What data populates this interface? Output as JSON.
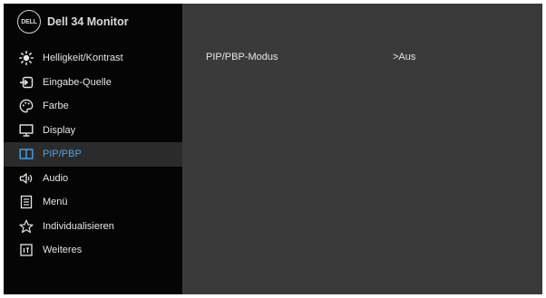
{
  "header": {
    "logo_text": "DELL",
    "model": "Dell  34 Monitor"
  },
  "menu": [
    {
      "label": "Helligkeit/Kontrast",
      "icon": "brightness-icon"
    },
    {
      "label": "Eingabe-Quelle",
      "icon": "input-source-icon"
    },
    {
      "label": "Farbe",
      "icon": "color-icon"
    },
    {
      "label": "Display",
      "icon": "display-icon"
    },
    {
      "label": "PIP/PBP",
      "icon": "pip-pbp-icon",
      "active": true
    },
    {
      "label": "Audio",
      "icon": "audio-icon"
    },
    {
      "label": "Menü",
      "icon": "menu-icon"
    },
    {
      "label": "Individualisieren",
      "icon": "star-icon"
    },
    {
      "label": "Weiteres",
      "icon": "others-icon"
    }
  ],
  "content": {
    "setting_label": "PIP/PBP-Modus",
    "setting_value": ">Aus"
  },
  "colors": {
    "accent": "#4aa3ea",
    "sidebar_bg": "#050505",
    "panel_bg": "#3a3a3a",
    "active_bg": "#2b2b2b"
  }
}
